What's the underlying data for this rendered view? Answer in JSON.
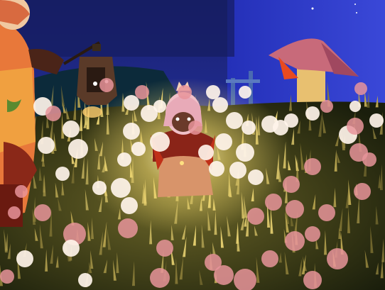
{
  "scene": {
    "description_free": true,
    "palette": {
      "wall_blue": "#2632b8",
      "wall_dark": "#141c5a",
      "grass_dark": "#1e2410",
      "grass_mid": "#4a4a1c",
      "grass_light": "#d8c868",
      "petal_pink": "#e89a9a",
      "petal_white": "#fff2ea",
      "glow": "#fff6b0",
      "roof_pink": "#c86a7a",
      "cape_red": "#a02818",
      "skin_orange": "#e8783a"
    }
  }
}
